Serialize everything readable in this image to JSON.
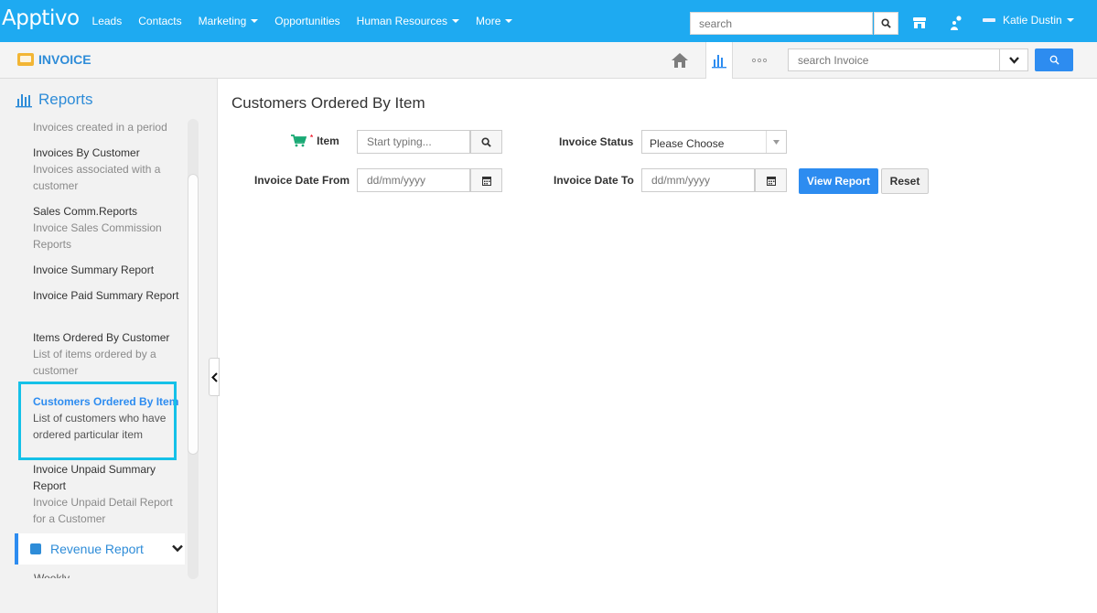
{
  "topbar": {
    "logo": "Apptivo",
    "nav": [
      {
        "label": "Leads",
        "dropdown": false
      },
      {
        "label": "Contacts",
        "dropdown": false
      },
      {
        "label": "Marketing",
        "dropdown": true
      },
      {
        "label": "Opportunities",
        "dropdown": false
      },
      {
        "label": "Human Resources",
        "dropdown": true
      },
      {
        "label": "More",
        "dropdown": true
      }
    ],
    "search_placeholder": "search",
    "user_name": "Katie Dustin",
    "icons": [
      "search-icon",
      "store-icon",
      "users-icon"
    ]
  },
  "appbar": {
    "title": "INVOICE",
    "search_placeholder": "search Invoice",
    "icons": [
      "home-icon",
      "bar-chart-icon",
      "more-dots-icon",
      "chevron-down-icon",
      "search-icon"
    ]
  },
  "sidebar": {
    "heading": "Reports",
    "items": [
      {
        "title": "",
        "desc": "Invoices created in a period"
      },
      {
        "title": "Invoices By Customer",
        "desc": "Invoices associated with a customer"
      },
      {
        "title": "Sales Comm.Reports",
        "desc": "Invoice Sales Commission Reports"
      },
      {
        "title": "Invoice Summary Report",
        "desc": ""
      },
      {
        "title": "Invoice Paid Summary Report",
        "desc": ""
      },
      {
        "title": "Items Ordered By Customer",
        "desc": "List of items ordered by a customer"
      },
      {
        "title": "Customers Ordered By Item",
        "desc": "List of customers who have ordered particular item"
      },
      {
        "title": "Invoice Unpaid Summary Report",
        "desc": "Invoice Unpaid Detail Report for a Customer"
      }
    ],
    "selected_index": 6,
    "revenue_label": "Revenue Report",
    "weekly_label": "Weekly"
  },
  "main": {
    "title": "Customers Ordered By Item",
    "item_label": "Item",
    "item_placeholder": "Start typing...",
    "status_label": "Invoice Status",
    "status_value": "Please Choose",
    "date_from_label": "Invoice Date From",
    "date_from_placeholder": "dd/mm/yyyy",
    "date_to_label": "Invoice Date To",
    "date_to_placeholder": "dd/mm/yyyy",
    "view_report": "View Report",
    "reset": "Reset"
  },
  "colors": {
    "brand": "#1eaaf1",
    "accent": "#2d8cf0",
    "selection": "#15c1e8",
    "cart": "#19a974"
  }
}
